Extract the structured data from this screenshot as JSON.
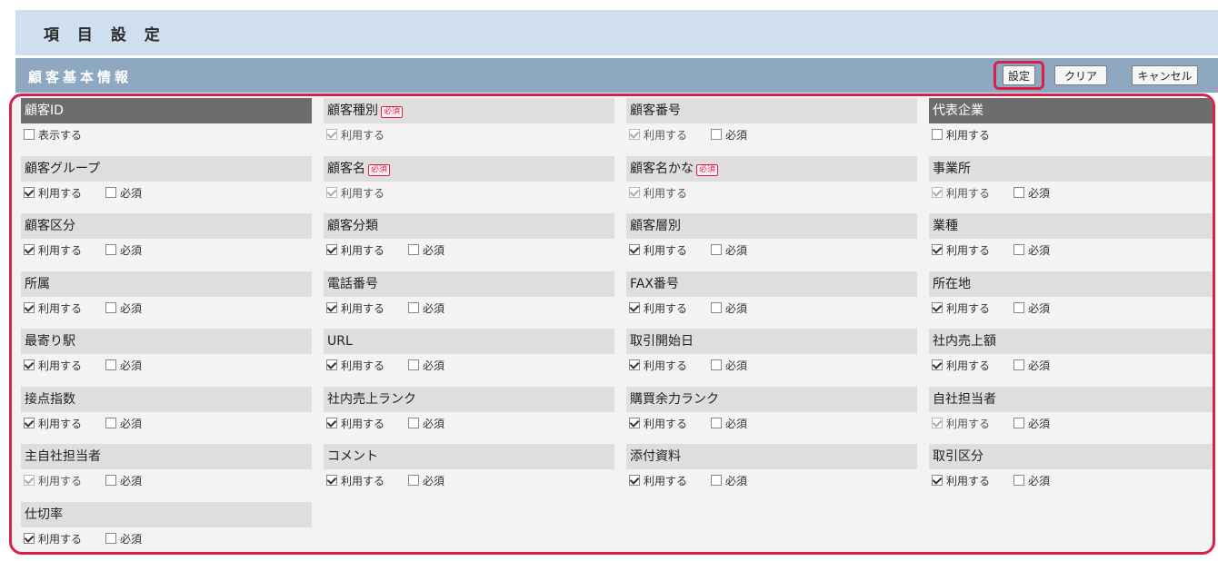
{
  "title": "項 目 設 定",
  "section": "顧客基本情報",
  "buttons": {
    "set": "設定",
    "clear": "クリア",
    "cancel": "キャンセル"
  },
  "option_labels": {
    "use": "利用する",
    "show": "表示する",
    "required": "必須"
  },
  "required_badge": "必須",
  "fields": [
    {
      "label": "顧客ID",
      "dark": true,
      "opt": "表示する",
      "checked": false,
      "disabled": false,
      "hasRequired": false,
      "requiredBadge": false
    },
    {
      "label": "顧客種別",
      "dark": false,
      "opt": "利用する",
      "checked": true,
      "disabled": true,
      "hasRequired": false,
      "requiredBadge": true
    },
    {
      "label": "顧客番号",
      "dark": false,
      "opt": "利用する",
      "checked": true,
      "disabled": true,
      "hasRequired": true,
      "requiredBadge": false
    },
    {
      "label": "代表企業",
      "dark": true,
      "opt": "利用する",
      "checked": false,
      "disabled": false,
      "hasRequired": false,
      "requiredBadge": false
    },
    {
      "label": "顧客グループ",
      "dark": false,
      "opt": "利用する",
      "checked": true,
      "disabled": false,
      "hasRequired": true,
      "requiredBadge": false
    },
    {
      "label": "顧客名",
      "dark": false,
      "opt": "利用する",
      "checked": true,
      "disabled": true,
      "hasRequired": false,
      "requiredBadge": true
    },
    {
      "label": "顧客名かな",
      "dark": false,
      "opt": "利用する",
      "checked": true,
      "disabled": true,
      "hasRequired": false,
      "requiredBadge": true
    },
    {
      "label": "事業所",
      "dark": false,
      "opt": "利用する",
      "checked": true,
      "disabled": true,
      "hasRequired": true,
      "requiredBadge": false
    },
    {
      "label": "顧客区分",
      "dark": false,
      "opt": "利用する",
      "checked": true,
      "disabled": false,
      "hasRequired": true,
      "requiredBadge": false
    },
    {
      "label": "顧客分類",
      "dark": false,
      "opt": "利用する",
      "checked": true,
      "disabled": false,
      "hasRequired": true,
      "requiredBadge": false
    },
    {
      "label": "顧客層別",
      "dark": false,
      "opt": "利用する",
      "checked": true,
      "disabled": false,
      "hasRequired": true,
      "requiredBadge": false
    },
    {
      "label": "業種",
      "dark": false,
      "opt": "利用する",
      "checked": true,
      "disabled": false,
      "hasRequired": true,
      "requiredBadge": false
    },
    {
      "label": "所属",
      "dark": false,
      "opt": "利用する",
      "checked": true,
      "disabled": false,
      "hasRequired": true,
      "requiredBadge": false
    },
    {
      "label": "電話番号",
      "dark": false,
      "opt": "利用する",
      "checked": true,
      "disabled": false,
      "hasRequired": true,
      "requiredBadge": false
    },
    {
      "label": "FAX番号",
      "dark": false,
      "opt": "利用する",
      "checked": true,
      "disabled": false,
      "hasRequired": true,
      "requiredBadge": false
    },
    {
      "label": "所在地",
      "dark": false,
      "opt": "利用する",
      "checked": true,
      "disabled": false,
      "hasRequired": true,
      "requiredBadge": false
    },
    {
      "label": "最寄り駅",
      "dark": false,
      "opt": "利用する",
      "checked": true,
      "disabled": false,
      "hasRequired": true,
      "requiredBadge": false
    },
    {
      "label": "URL",
      "dark": false,
      "opt": "利用する",
      "checked": true,
      "disabled": false,
      "hasRequired": true,
      "requiredBadge": false
    },
    {
      "label": "取引開始日",
      "dark": false,
      "opt": "利用する",
      "checked": true,
      "disabled": false,
      "hasRequired": true,
      "requiredBadge": false
    },
    {
      "label": "社内売上額",
      "dark": false,
      "opt": "利用する",
      "checked": true,
      "disabled": false,
      "hasRequired": true,
      "requiredBadge": false
    },
    {
      "label": "接点指数",
      "dark": false,
      "opt": "利用する",
      "checked": true,
      "disabled": false,
      "hasRequired": true,
      "requiredBadge": false
    },
    {
      "label": "社内売上ランク",
      "dark": false,
      "opt": "利用する",
      "checked": true,
      "disabled": false,
      "hasRequired": true,
      "requiredBadge": false
    },
    {
      "label": "購買余力ランク",
      "dark": false,
      "opt": "利用する",
      "checked": true,
      "disabled": false,
      "hasRequired": true,
      "requiredBadge": false
    },
    {
      "label": "自社担当者",
      "dark": false,
      "opt": "利用する",
      "checked": true,
      "disabled": true,
      "hasRequired": true,
      "requiredBadge": false
    },
    {
      "label": "主自社担当者",
      "dark": false,
      "opt": "利用する",
      "checked": true,
      "disabled": true,
      "hasRequired": true,
      "requiredBadge": false
    },
    {
      "label": "コメント",
      "dark": false,
      "opt": "利用する",
      "checked": true,
      "disabled": false,
      "hasRequired": true,
      "requiredBadge": false
    },
    {
      "label": "添付資料",
      "dark": false,
      "opt": "利用する",
      "checked": true,
      "disabled": false,
      "hasRequired": true,
      "requiredBadge": false
    },
    {
      "label": "取引区分",
      "dark": false,
      "opt": "利用する",
      "checked": true,
      "disabled": false,
      "hasRequired": true,
      "requiredBadge": false
    },
    {
      "label": "仕切率",
      "dark": false,
      "opt": "利用する",
      "checked": true,
      "disabled": false,
      "hasRequired": true,
      "requiredBadge": false
    }
  ]
}
